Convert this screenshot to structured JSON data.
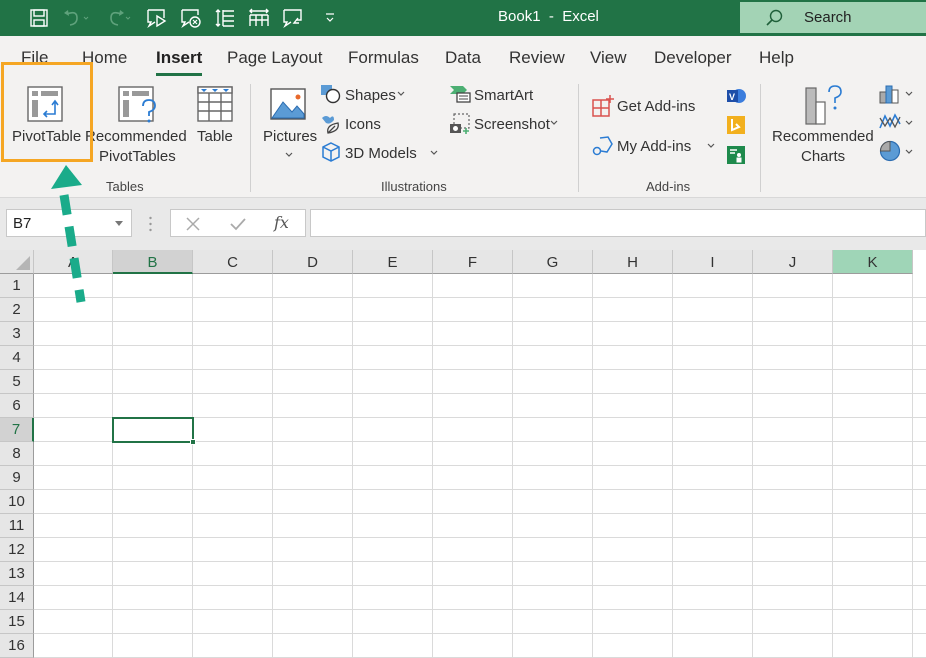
{
  "titlebar": {
    "title": "Book1  -  Excel",
    "search_label": "Search",
    "qat_icons": [
      "save-icon",
      "undo-icon",
      "redo-icon",
      "slideshow-icon",
      "clear-icon",
      "row-height-icon",
      "column-width-icon",
      "comment-icon",
      "customize-qat-icon"
    ]
  },
  "tabs": [
    {
      "label": "File"
    },
    {
      "label": "Home"
    },
    {
      "label": "Insert",
      "active": true
    },
    {
      "label": "Page Layout"
    },
    {
      "label": "Formulas"
    },
    {
      "label": "Data"
    },
    {
      "label": "Review"
    },
    {
      "label": "View"
    },
    {
      "label": "Developer"
    },
    {
      "label": "Help"
    }
  ],
  "ribbon": {
    "tables": {
      "group_label": "Tables",
      "pivottable": "PivotTable",
      "recommended_line1": "Recommended",
      "recommended_line2": "PivotTables",
      "table": "Table"
    },
    "illustrations": {
      "group_label": "Illustrations",
      "pictures": "Pictures",
      "shapes": "Shapes",
      "icons": "Icons",
      "models": "3D Models",
      "smartart": "SmartArt",
      "screenshot": "Screenshot"
    },
    "addins": {
      "group_label": "Add-ins",
      "get": "Get Add-ins",
      "my": "My Add-ins"
    },
    "charts": {
      "recommended_line1": "Recommended",
      "recommended_line2": "Charts"
    }
  },
  "formula_bar": {
    "name_box": "B7",
    "fx_label": "fx",
    "value": ""
  },
  "grid": {
    "columns": [
      "A",
      "B",
      "C",
      "D",
      "E",
      "F",
      "G",
      "H",
      "I",
      "J",
      "K"
    ],
    "rows": [
      "1",
      "2",
      "3",
      "4",
      "5",
      "6",
      "7",
      "8",
      "9",
      "10",
      "11",
      "12",
      "13",
      "14",
      "15",
      "16"
    ],
    "selected_cell": "B7",
    "highlighted_column": "K"
  },
  "annotation": {
    "highlight_color": "#f5a623",
    "arrow_color": "#1aab8a",
    "target": "PivotTable"
  },
  "colors": {
    "excel_green": "#217346",
    "search_bg": "#a3d3b5",
    "ribbon_bg": "#f3f2f1"
  }
}
